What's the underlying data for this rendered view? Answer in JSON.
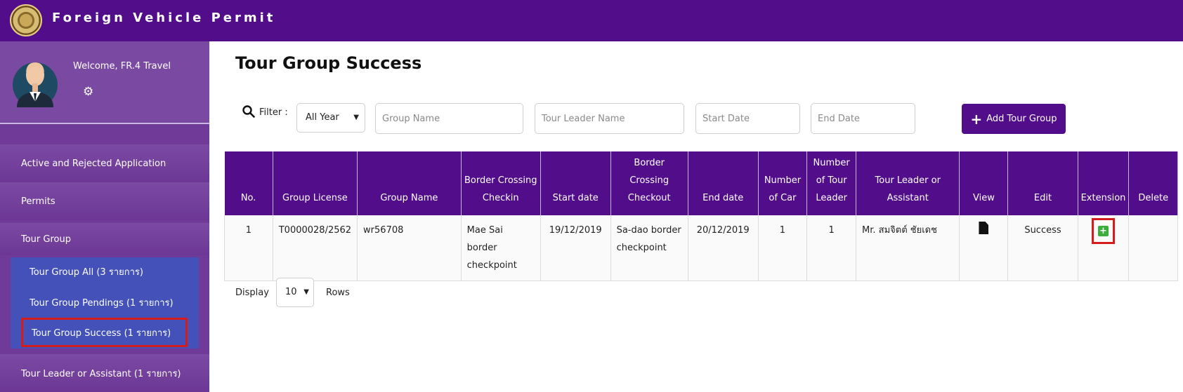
{
  "header": {
    "app_title": "Foreign Vehicle Permit"
  },
  "sidebar": {
    "welcome": "Welcome, FR.4 Travel",
    "items": [
      {
        "label": "Active and Rejected Application"
      },
      {
        "label": "Permits"
      },
      {
        "label": "Tour Group"
      },
      {
        "label": "Tour Leader or Assistant (1 รายการ)"
      }
    ],
    "sub_items": [
      {
        "label": "Tour Group All (3 รายการ)"
      },
      {
        "label": "Tour Group Pendings (1 รายการ)"
      },
      {
        "label": "Tour Group Success (1 รายการ)"
      }
    ]
  },
  "main": {
    "title": "Tour Group Success",
    "filter_label": "Filter :",
    "year_select": "All Year",
    "group_name_placeholder": "Group Name",
    "tour_leader_placeholder": "Tour Leader Name",
    "start_date_placeholder": "Start Date",
    "end_date_placeholder": "End Date",
    "add_button": "Add Tour Group"
  },
  "table": {
    "headers": {
      "no": "No.",
      "group_license": "Group License",
      "group_name": "Group Name",
      "border_checkin": "Border Crossing Checkin",
      "start_date": "Start date",
      "border_checkout": "Border Crossing Checkout",
      "end_date": "End date",
      "num_car": "Number of Car",
      "num_leader": "Number of Tour Leader",
      "tour_leader": "Tour Leader or Assistant",
      "view": "View",
      "edit": "Edit",
      "extension": "Extension",
      "delete": "Delete"
    },
    "rows": [
      {
        "no": "1",
        "group_license": "T0000028/2562",
        "group_name": "wr56708",
        "border_checkin": "Mae Sai border checkpoint",
        "start_date": "19/12/2019",
        "border_checkout": "Sa-dao border checkpoint",
        "end_date": "20/12/2019",
        "num_car": "1",
        "num_leader": "1",
        "tour_leader": "Mr. สมจิตต์ ชัยเดช",
        "edit": "Success"
      }
    ]
  },
  "footer": {
    "display_label": "Display",
    "rows_value": "10",
    "rows_label": "Rows"
  },
  "icons": {
    "settings": "gear-icon",
    "filter": "search-icon",
    "view": "document-icon",
    "extension": "plus-square-icon",
    "add": "plus-icon"
  },
  "colors": {
    "brand": "#520e8a",
    "sidebar": "#6f3a98",
    "submenu": "#4351b8",
    "highlight": "#d41c1c",
    "extension_green": "#3cae3c"
  }
}
